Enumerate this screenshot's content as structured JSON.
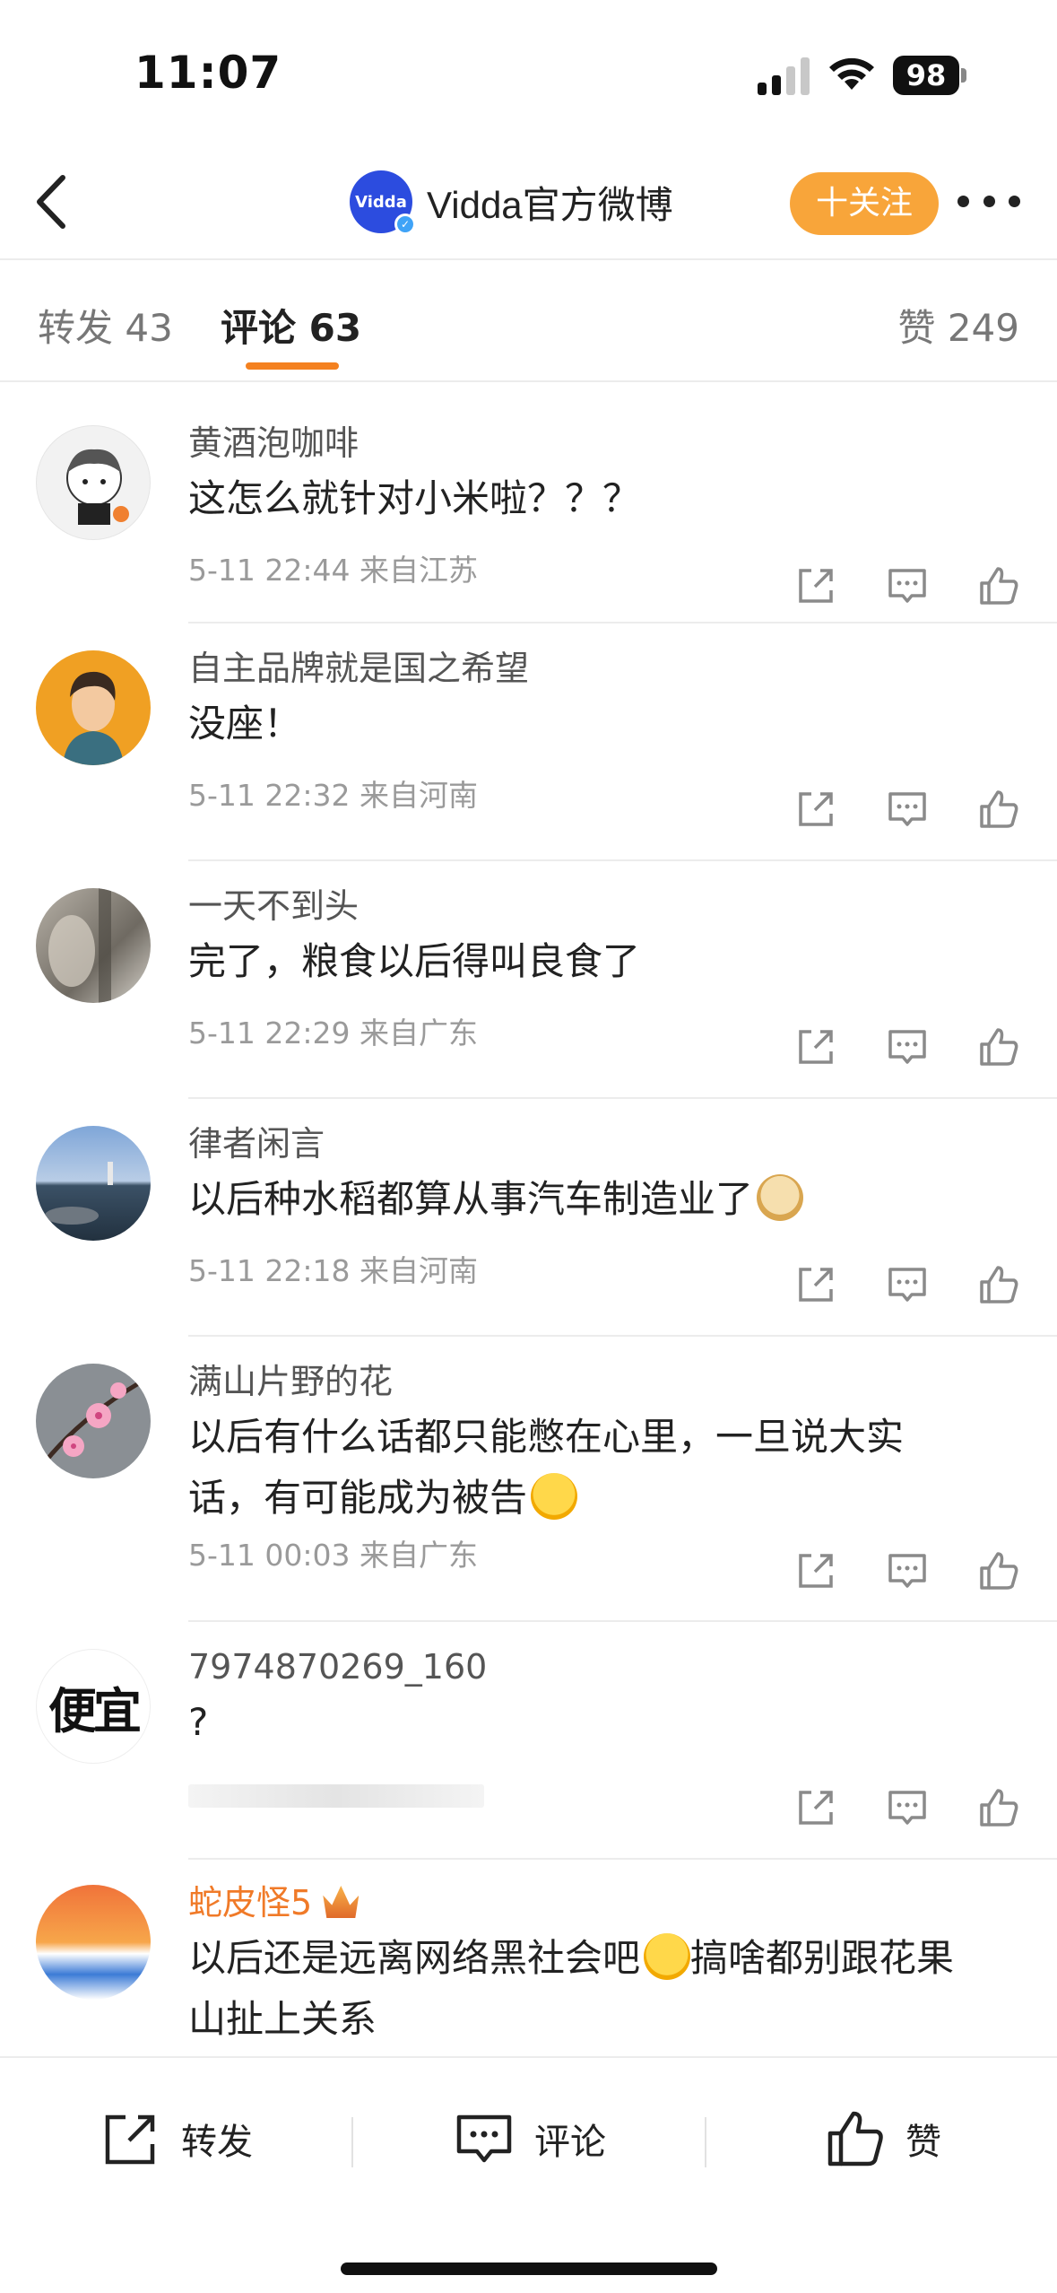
{
  "status_bar": {
    "time": "11:07",
    "battery": "98"
  },
  "nav": {
    "avatar_text": "Vidda",
    "title": "Vidda官方微博",
    "follow_label": "十关注"
  },
  "tabs": {
    "repost": "转发 43",
    "comment": "评论 63",
    "like": "赞 249"
  },
  "comments": [
    {
      "name": "黄酒泡咖啡",
      "text": "这怎么就针对小米啦？？？",
      "meta": "5-11 22:44  来自江苏"
    },
    {
      "name": "自主品牌就是国之希望",
      "text": "没座！",
      "meta": "5-11 22:32  来自河南"
    },
    {
      "name": "一天不到头",
      "text": "完了，粮食以后得叫良食了",
      "meta": "5-11 22:29  来自广东"
    },
    {
      "name": "律者闲言",
      "text": "以后种水稻都算从事汽车制造业了",
      "meta": "5-11 22:18  来自河南",
      "emoji": "doge-emoji"
    },
    {
      "name": "满山片野的花",
      "text_line1": "以后有什么话都只能憋在心里，一旦说大实",
      "text_line2": "话，有可能成为被告",
      "meta": "5-11 00:03  来自广东",
      "emoji": "laugh-cry-emoji"
    },
    {
      "name": "7974870269_160",
      "text": "?",
      "avatar_text": "便宜"
    },
    {
      "name": "蛇皮怪5",
      "text_line1": "以后还是远离网络黑社会吧",
      "text_line1b": "搞啥都别跟花果",
      "text_line2": "山扯上关系",
      "emoji": "laugh-cry-emoji",
      "badge": "crown-icon"
    }
  ],
  "bottom_bar": {
    "repost": "转发",
    "comment": "评论",
    "like": "赞"
  },
  "colors": {
    "accent": "#f48120",
    "follow": "#f8a53a",
    "brand_blue": "#2c4cdf",
    "vip_name": "#f07a28"
  }
}
